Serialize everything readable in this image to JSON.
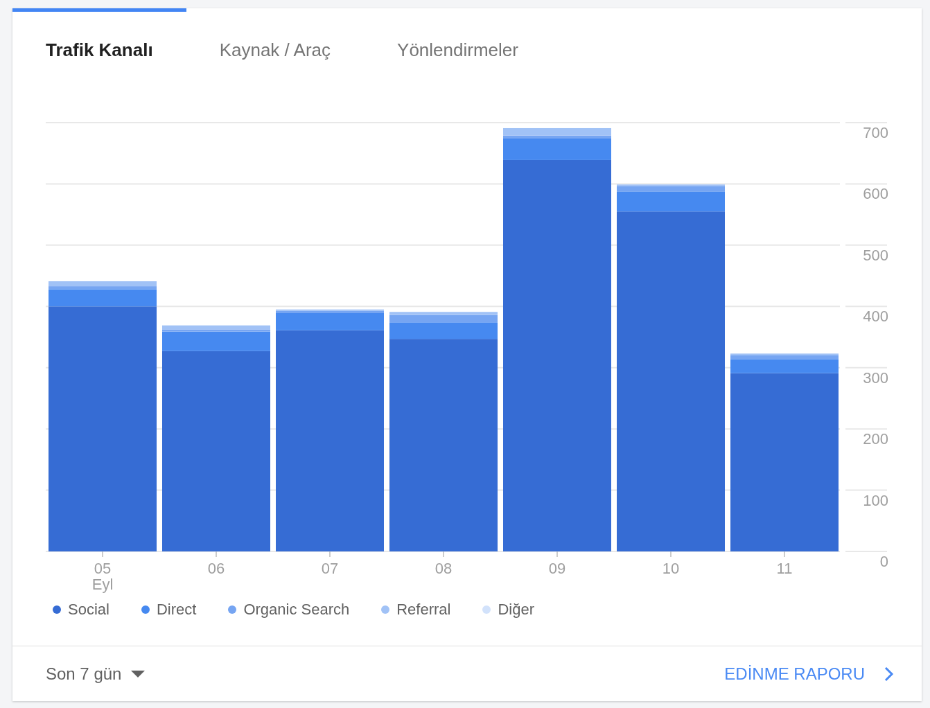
{
  "tabs": [
    {
      "label": "Trafik Kanalı",
      "selected": true
    },
    {
      "label": "Kaynak / Araç",
      "selected": false
    },
    {
      "label": "Yönlendirmeler",
      "selected": false
    }
  ],
  "chart": {
    "month_label": "Eyl",
    "chart_data": {
      "type": "bar",
      "stacked": true,
      "categories": [
        "05",
        "06",
        "07",
        "08",
        "09",
        "10",
        "11"
      ],
      "series": [
        {
          "name": "Social",
          "color": "#366cd4",
          "values": [
            400,
            327,
            361,
            347,
            639,
            555,
            291
          ]
        },
        {
          "name": "Direct",
          "color": "#4689f0",
          "values": [
            28,
            32,
            28,
            27,
            35,
            32,
            23
          ]
        },
        {
          "name": "Organic Search",
          "color": "#76a5f2",
          "values": [
            5,
            3,
            4,
            12,
            5,
            9,
            6
          ]
        },
        {
          "name": "Referral",
          "color": "#a1c2f6",
          "values": [
            8,
            7,
            2,
            5,
            12,
            3,
            3
          ]
        },
        {
          "name": "Diğer",
          "color": "#d2e2fb",
          "values": [
            null,
            null,
            null,
            null,
            null,
            null,
            null
          ]
        }
      ],
      "ylim": [
        0,
        700
      ],
      "grid": true,
      "yticks": [
        0,
        100,
        200,
        300,
        400,
        500,
        600,
        700
      ]
    }
  },
  "footer": {
    "period": "Son 7 gün",
    "link": "EDİNME RAPORU"
  }
}
